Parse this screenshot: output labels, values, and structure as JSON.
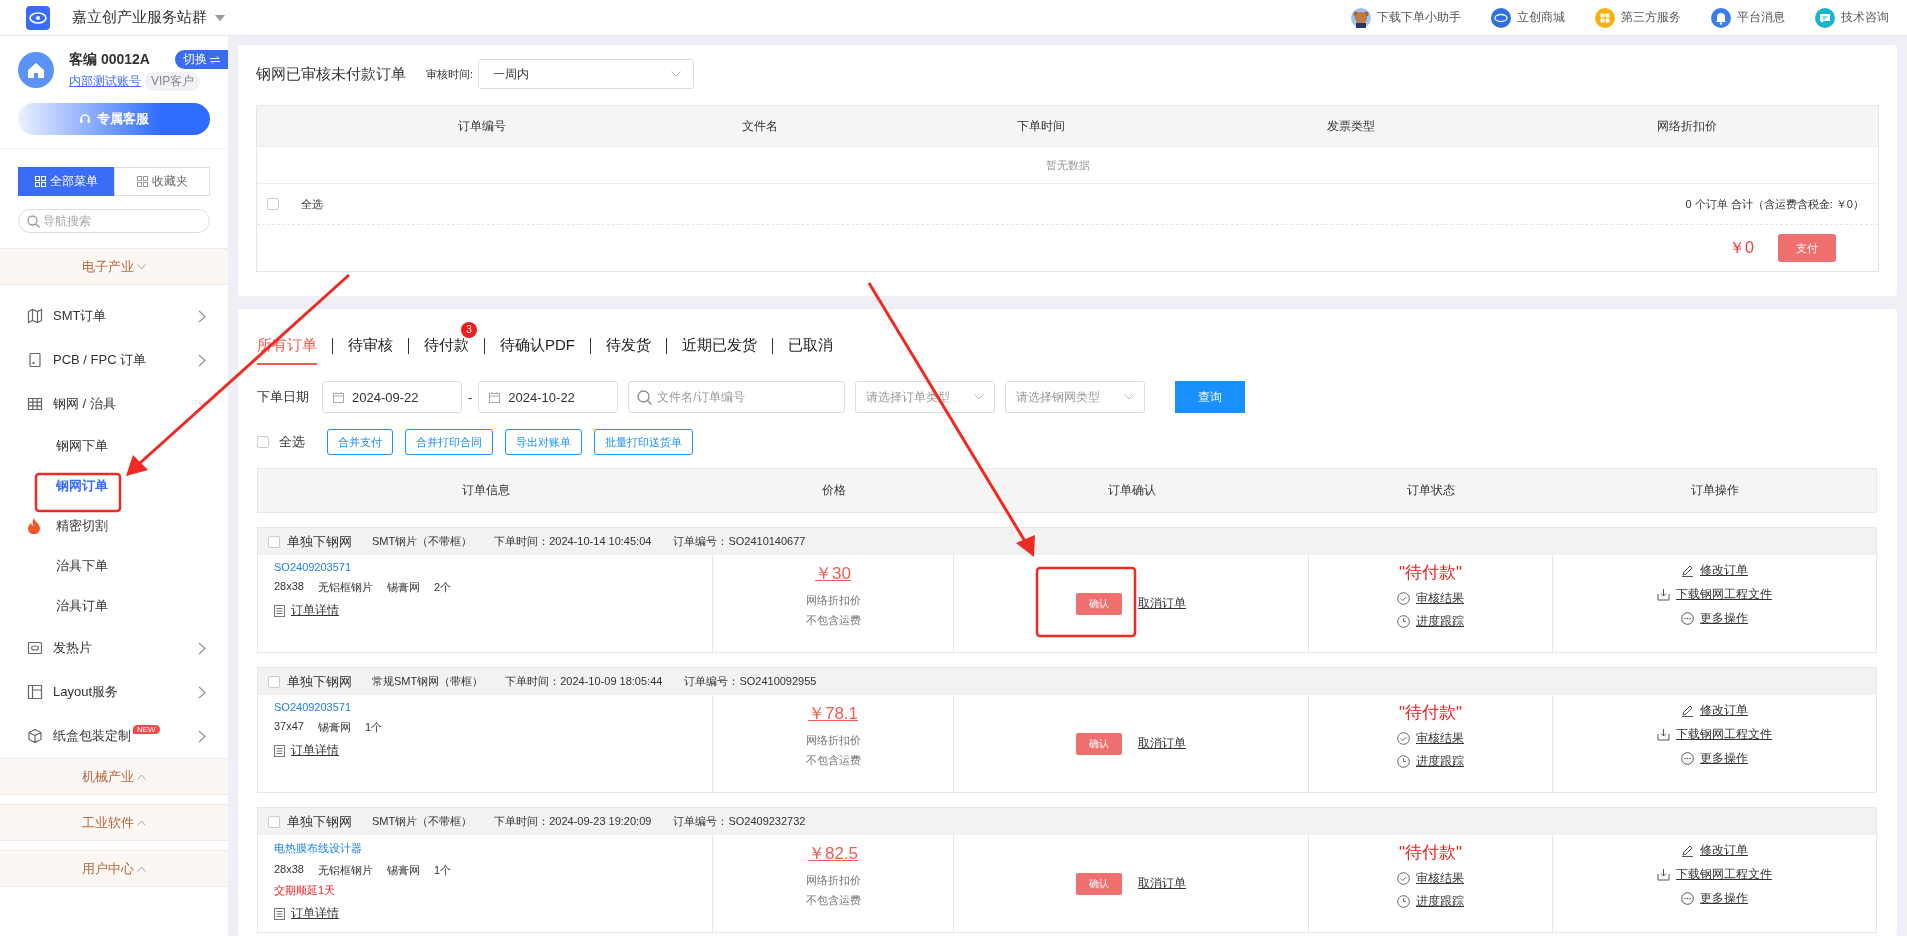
{
  "topbar": {
    "site_title": "嘉立创产业服务站群",
    "links": [
      "下载下单小助手",
      "立创商城",
      "第三方服务",
      "平台消息",
      "技术咨询"
    ]
  },
  "sidebar": {
    "account": {
      "customer_id": "客编 00012A",
      "switch_button": "切换",
      "account_link": "内部测试账号",
      "badge": "VIP客户"
    },
    "service_button": "专属客服",
    "menu_tabs": [
      {
        "label": "全部菜单",
        "selected": true
      },
      {
        "label": "收藏夹",
        "selected": false
      }
    ],
    "search": {
      "placeholder": "导航搜索"
    },
    "sections": [
      {
        "title": "电子产业",
        "expanded": true,
        "items": [
          {
            "label": "SMT订单",
            "expanded": false
          },
          {
            "label": "PCB / FPC 订单",
            "expanded": false
          },
          {
            "label": "钢网 / 治具",
            "expanded": true,
            "children": [
              {
                "label": "钢网下单",
                "selected": false,
                "hot": false
              },
              {
                "label": "钢网订单",
                "selected": true,
                "hot": false
              },
              {
                "label": "精密切割",
                "selected": false,
                "hot": true
              },
              {
                "label": "治具下单",
                "selected": false,
                "hot": false
              },
              {
                "label": "治具订单",
                "selected": false,
                "hot": false
              }
            ]
          },
          {
            "label": "发热片",
            "expanded": false
          },
          {
            "label": "Layout服务",
            "expanded": false
          },
          {
            "label": "纸盒包装定制",
            "expanded": false,
            "badge": "NEW"
          }
        ]
      },
      {
        "title": "机械产业",
        "expanded": false
      },
      {
        "title": "工业软件",
        "expanded": false
      },
      {
        "title": "用户中心",
        "expanded": false
      }
    ]
  },
  "unpaid_panel": {
    "title": "钢网已审核未付款订单",
    "filter_label": "审核时间:",
    "filter_value": "一周内",
    "columns": [
      "订单编号",
      "文件名",
      "下单时间",
      "发票类型",
      "网络折扣价"
    ],
    "empty_text": "暂无数据",
    "select_all": {
      "label": "全选",
      "checked": false
    },
    "summary": "0 个订单 合计（含运费含税金: ￥0）",
    "total": "￥0",
    "pay_button": "支付"
  },
  "orders_panel": {
    "tabs": [
      {
        "label": "所有订单",
        "selected": true
      },
      {
        "label": "待审核",
        "selected": false
      },
      {
        "label": "待付款",
        "selected": false,
        "badge": "3"
      },
      {
        "label": "待确认PDF",
        "selected": false
      },
      {
        "label": "待发货",
        "selected": false
      },
      {
        "label": "近期已发货",
        "selected": false
      },
      {
        "label": "已取消",
        "selected": false
      }
    ],
    "filter": {
      "date_label": "下单日期",
      "date_from": "2024-09-22",
      "date_separator": "-",
      "date_to": "2024-10-22",
      "search_placeholder": "文件名/订单编号",
      "order_type_placeholder": "请选择订单类型",
      "stencil_type_placeholder": "请选择钢网类型",
      "query_button": "查询"
    },
    "select_all": {
      "label": "全选",
      "checked": false
    },
    "actions": [
      "合并支付",
      "合并打印合同",
      "导出对账单",
      "批量打印送货单"
    ],
    "columns": [
      "订单信息",
      "价格",
      "订单确认",
      "订单状态",
      "订单操作"
    ],
    "orders": [
      {
        "checked": false,
        "type": "单独下钢网",
        "product": "SMT钢片（不带框）",
        "time": "下单时间：2024-10-14 10:45:04",
        "order_no": "订单编号：SO2410140677",
        "file": "SO2409203571",
        "specs": [
          "28x38",
          "无铝框钢片",
          "锡膏网",
          "2个"
        ],
        "detail": "订单详情",
        "price": "￥30",
        "price_note": "网络折扣价",
        "shipping": "不包含运费",
        "confirm": "确认",
        "cancel": "取消订单",
        "status": "\"待付款\"",
        "status_links": [
          "审核结果",
          "进度跟踪"
        ],
        "operations": [
          "修改订单",
          "下载钢网工程文件",
          "更多操作"
        ]
      },
      {
        "checked": false,
        "type": "单独下钢网",
        "product": "常规SMT钢网（带框）",
        "time": "下单时间：2024-10-09 18:05:44",
        "order_no": "订单编号：SO2410092955",
        "file": "SO2409203571",
        "specs": [
          "37x47",
          "锡膏网",
          "1个"
        ],
        "detail": "订单详情",
        "price": "￥78.1",
        "price_note": "网络折扣价",
        "shipping": "不包含运费",
        "confirm": "确认",
        "cancel": "取消订单",
        "status": "\"待付款\"",
        "status_links": [
          "审核结果",
          "进度跟踪"
        ],
        "operations": [
          "修改订单",
          "下载钢网工程文件",
          "更多操作"
        ]
      },
      {
        "checked": false,
        "type": "单独下钢网",
        "product": "SMT钢片（不带框）",
        "time": "下单时间：2024-09-23 19:20:09",
        "order_no": "订单编号：SO2409232732",
        "file": "电热膜布线设计器",
        "specs": [
          "28x38",
          "无铝框钢片",
          "锡膏网",
          "1个"
        ],
        "notice": "交期顺延1天",
        "detail": "订单详情",
        "price": "￥82.5",
        "price_note": "网络折扣价",
        "shipping": "不包含运费",
        "confirm": "确认",
        "cancel": "取消订单",
        "status": "\"待付款\"",
        "status_links": [
          "审核结果",
          "进度跟踪"
        ],
        "operations": [
          "修改订单",
          "下载钢网工程文件",
          "更多操作"
        ]
      }
    ]
  }
}
